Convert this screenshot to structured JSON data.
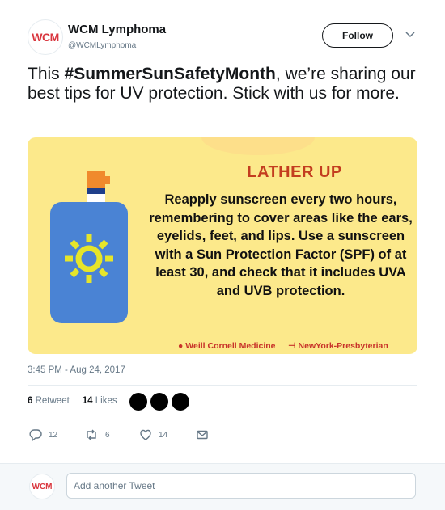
{
  "header": {
    "avatar_text": "WCM",
    "display_name": "WCM Lymphoma",
    "handle": "@WCMLymphoma",
    "follow_label": "Follow"
  },
  "tweet": {
    "text_prefix": "This ",
    "hashtag": "#SummerSunSafetyMonth",
    "text_suffix": ", we’re sharing our best tips for UV protection. Stick with us for more.",
    "timestamp": "3:45 PM - Aug 24, 2017"
  },
  "card": {
    "title": "LATHER UP",
    "body": "Reapply sunscreen every two hours, remembering to cover areas like the ears, eyelids, feet, and lips. Use a sunscreen with a Sun Protection Factor (SPF) of at least 30, and check that it includes UVA and UVB protection.",
    "logo_left": "Weill Cornell Medicine",
    "logo_right": "NewYork-Presbyterian"
  },
  "stats": {
    "retweet_count": "6",
    "retweet_label": "Retweet",
    "likes_count": "14",
    "likes_label": "Likes"
  },
  "actions": {
    "reply_count": "12",
    "retweet_count": "6",
    "like_count": "14"
  },
  "reply_bar": {
    "avatar_text": "WCM",
    "placeholder": "Add another Tweet"
  },
  "colors": {
    "card_bg": "#fce98b",
    "title_red": "#c33d1f",
    "bottle_blue": "#4a83d4",
    "sun_yellow": "#e6e52a",
    "cap_orange": "#f08a2c"
  }
}
